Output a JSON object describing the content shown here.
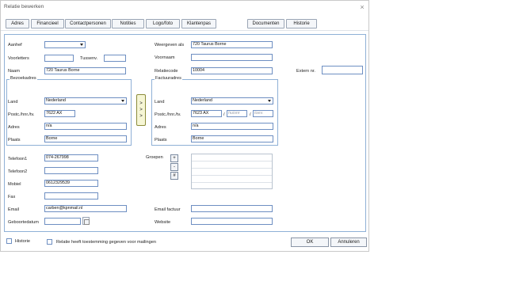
{
  "window": {
    "title": "Relatie bewerken",
    "close_glyph": "×"
  },
  "tabs": [
    "Adres",
    "Financieel",
    "Contactpersonen",
    "Notities",
    "Logo/foto",
    "Klantenpas",
    "Documenten",
    "Historie"
  ],
  "left": {
    "aanhef_label": "Aanhef",
    "aanhef_value": "",
    "voorletters_label": "Voorletters",
    "voorletters_value": "",
    "tussenv_label": "Tussenv.",
    "tussenv_value": "",
    "naam_label": "Naam",
    "naam_value": "720 Taurus Borne"
  },
  "right": {
    "weergeven_label": "Weergeven als",
    "weergeven_value": "720 Taurus Borne",
    "voornaam_label": "Voornaam",
    "voornaam_value": "",
    "relatiecode_label": "Relatiecode",
    "relatiecode_value": "10004",
    "extern_label": "Extern nr.",
    "extern_value": ""
  },
  "bezoekadres": {
    "legend": "Bezoekadres",
    "land_label": "Land",
    "land_value": "Nederland",
    "postc_label": "Postc./hnr./tv.",
    "postc_value": "7622 AX",
    "adres_label": "Adres",
    "adres_value": "n/a",
    "plaats_label": "Plaats",
    "plaats_value": "Borne"
  },
  "copy_buttons": [
    ">",
    ">",
    ">"
  ],
  "factuuradres": {
    "legend": "Factuuradres",
    "land_label": "Land",
    "land_value": "Nederland",
    "postc_label": "Postc./hnr./tv.",
    "postc_value": "7623 AX",
    "huisnr_placeholder": "huisnr",
    "toev_placeholder": "toev.",
    "slash": "/",
    "adres_label": "Adres",
    "adres_value": "n/a",
    "plaats_label": "Plaats",
    "plaats_value": "Borne"
  },
  "contact": {
    "telefoon1_label": "Telefoon1",
    "telefoon1_value": "074-267998",
    "telefoon2_label": "Telefoon2",
    "telefoon2_value": "",
    "mobiel_label": "Mobiel",
    "mobiel_value": "0612329539",
    "fax_label": "Fax",
    "fax_value": "",
    "email_label": "Email",
    "email_value": "carben@kpnmail.nl",
    "geboortedatum_label": "Geboortedatum",
    "geboortedatum_value": ""
  },
  "groepen": {
    "label": "Groepen",
    "buttons": [
      "+",
      "-",
      "#"
    ]
  },
  "email_factuur": {
    "label": "Email factuur",
    "value": ""
  },
  "website": {
    "label": "Website",
    "value": ""
  },
  "footer": {
    "historie_label": "Historie",
    "toestemming_label": "Relatie heeft toestemming gegeven voor mailingen",
    "ok_label": "OK",
    "annuleren_label": "Annuleren"
  }
}
